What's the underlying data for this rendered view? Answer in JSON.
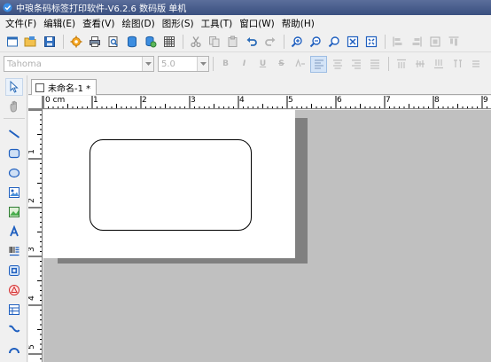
{
  "window": {
    "title": "中琅条码标签打印软件-V6.2.6 数码版 单机"
  },
  "menu": [
    "文件(F)",
    "编辑(E)",
    "查看(V)",
    "绘图(D)",
    "图形(S)",
    "工具(T)",
    "窗口(W)",
    "帮助(H)"
  ],
  "toolbar_main": {
    "icons": [
      "new-icon",
      "open-icon",
      "save-icon",
      "settings-icon",
      "print-icon",
      "print-preview-icon",
      "database-icon",
      "database-settings-icon",
      "grid-icon",
      "cut-icon",
      "copy-icon",
      "paste-icon",
      "undo-icon",
      "redo-icon",
      "zoom-in-icon",
      "zoom-out-icon",
      "zoom-actual-icon",
      "zoom-fit-icon",
      "zoom-page-icon",
      "align-left-icon",
      "align-right-icon",
      "align-center-icon",
      "align-top-icon"
    ]
  },
  "toolbar_format": {
    "font_name": "Tahoma",
    "font_size": "5.0",
    "bold_label": "B",
    "italic_label": "I",
    "underline_label": "U",
    "strike_label": "S"
  },
  "document": {
    "tab_label": "未命名-1 *",
    "ruler_unit": "0 cm",
    "h_ruler_labels": [
      "1",
      "2",
      "3",
      "4",
      "5",
      "6",
      "7",
      "8",
      "9"
    ],
    "v_ruler_labels": [
      "1",
      "2",
      "3",
      "4",
      "5"
    ]
  },
  "colors": {
    "titlebar": "#394f7f",
    "canvas_bg": "#c0c0c0",
    "paper": "#ffffff",
    "paper_shadow": "#808080",
    "accent_blue": "#1f5fbf"
  }
}
